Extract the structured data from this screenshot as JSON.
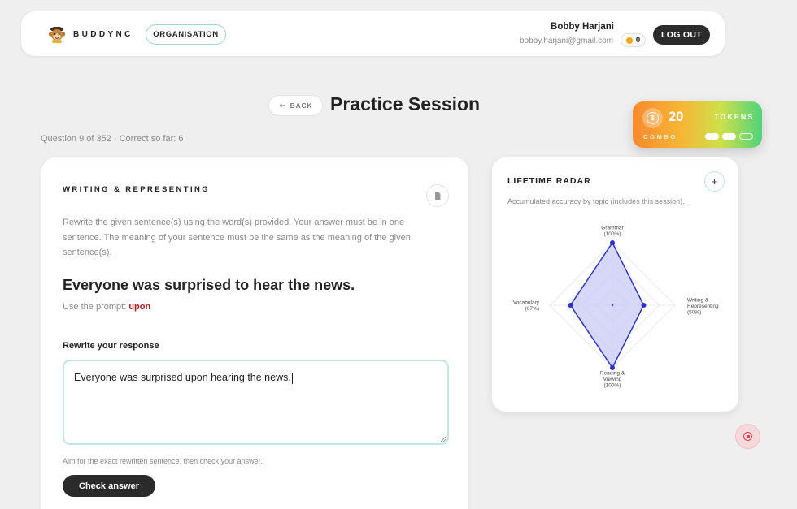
{
  "header": {
    "brand": "BUDDYNC",
    "org_button": "ORGANISATION",
    "user_name": "Bobby Harjani",
    "user_email": "bobby.harjani@gmail.com",
    "coin_count": "0",
    "logout": "LOG OUT"
  },
  "page": {
    "back": "BACK",
    "title": "Practice Session",
    "progress": "Question 9 of 352 · Correct so far: 6"
  },
  "tokens": {
    "count": "20",
    "label": "TOKENS",
    "combo_label": "COMBO",
    "combo_filled": 2,
    "combo_total": 3,
    "gradient": [
      "#f8892e",
      "#f6b735",
      "#cde04a",
      "#4fd37c"
    ]
  },
  "question": {
    "section": "WRITING & REPRESENTING",
    "instruction": "Rewrite the given sentence(s) using the word(s) provided. Your answer must be in one sentence. The meaning of your sentence must be the same as the meaning of the given sentence(s).",
    "sentence": "Everyone was surprised to hear the news.",
    "prompt_prefix": "Use the prompt: ",
    "prompt_word": "upon",
    "response_label": "Rewrite your response",
    "response_value": "Everyone was surprised upon hearing the news.",
    "hint": "Aim for the exact rewritten sentence, then check your answer.",
    "check_button": "Check answer"
  },
  "radar": {
    "title": "LIFETIME RADAR",
    "subtitle": "Accumulated accuracy by topic (includes this session).",
    "add_icon": "plus-icon",
    "accent_color": "#2b33c9",
    "fill_color": "#c9cbf5",
    "axes": [
      {
        "name": "Grammar",
        "value": 100,
        "value_label": "(100%)"
      },
      {
        "name": "Writing & Representing",
        "name_lines": [
          "Writing &",
          "Representing"
        ],
        "value": 50,
        "value_label": "(50%)"
      },
      {
        "name": "Reading & Viewing",
        "name_lines": [
          "Reading &",
          "Viewing"
        ],
        "value": 100,
        "value_label": "(100%)"
      },
      {
        "name": "Vocabulary",
        "value": 67,
        "value_label": "(67%)"
      }
    ]
  },
  "icons": {
    "logo": "monkey-logo-icon",
    "back": "arrow-left-icon",
    "doc": "document-icon",
    "coin": "coin-icon",
    "record": "stop-record-icon"
  }
}
